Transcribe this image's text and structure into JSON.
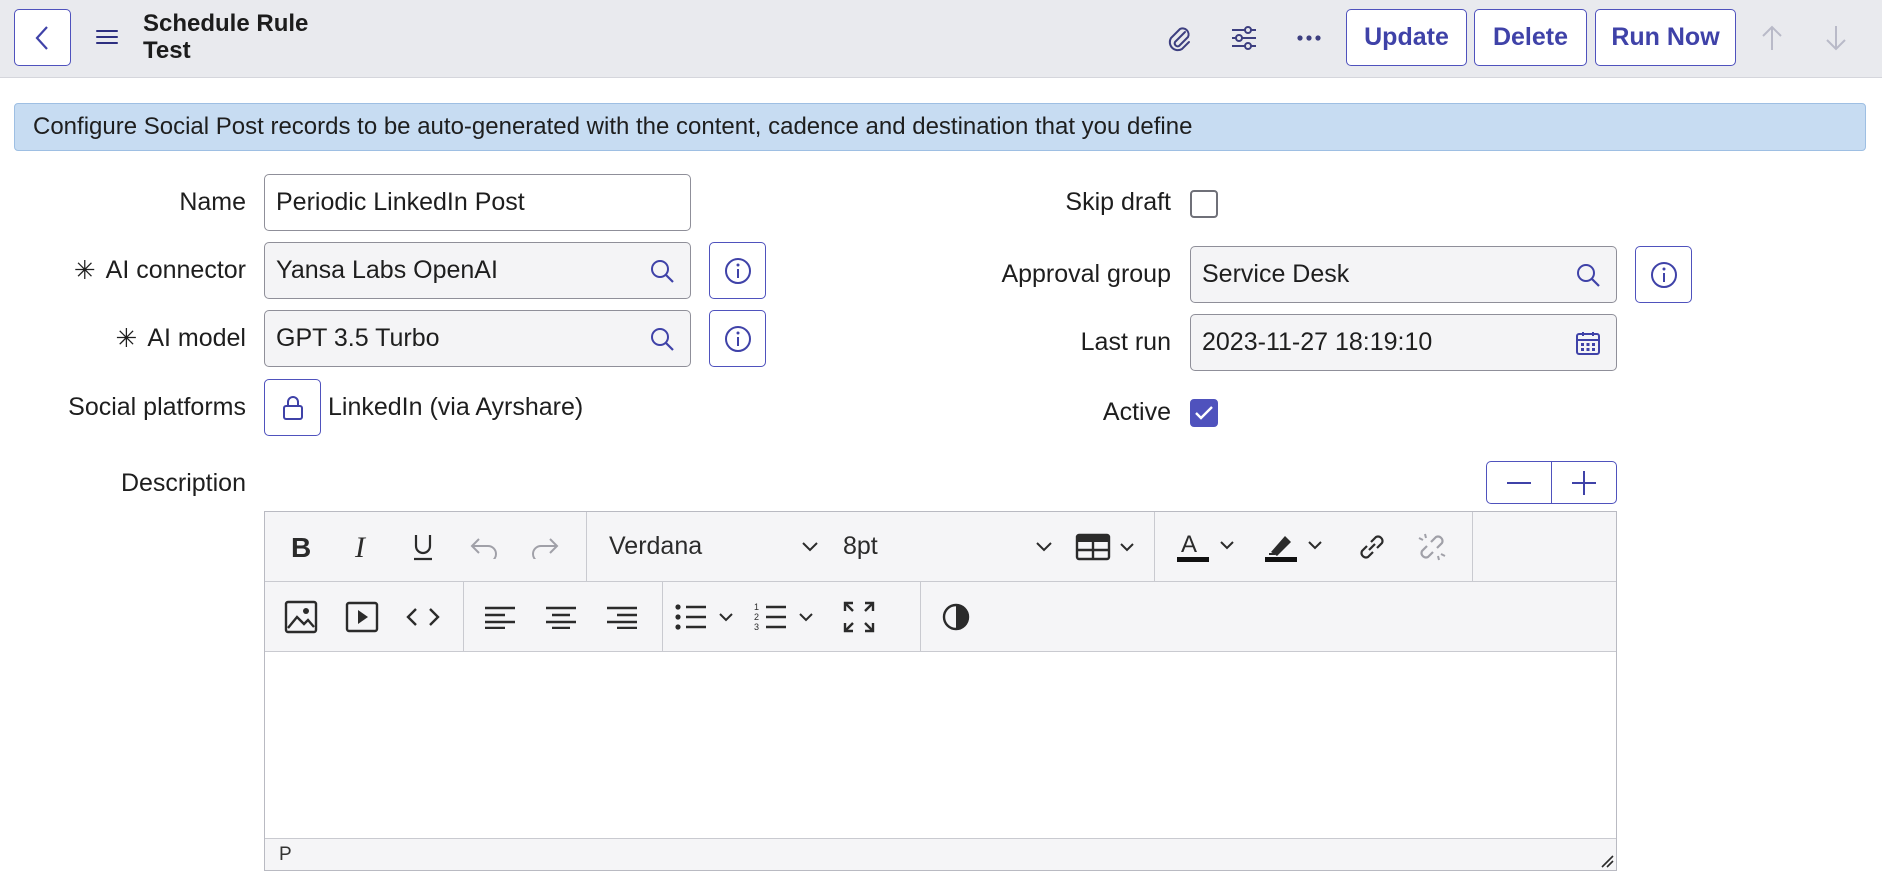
{
  "header": {
    "title": "Schedule Rule Test",
    "buttons": {
      "update": "Update",
      "delete": "Delete",
      "run_now": "Run Now"
    }
  },
  "banner": {
    "text": "Configure Social Post records to be auto-generated with the content, cadence and destination that you define"
  },
  "form": {
    "name": {
      "label": "Name",
      "value": "Periodic LinkedIn Post"
    },
    "ai_connector": {
      "label": "AI connector",
      "value": "Yansa Labs OpenAI",
      "required_mark": "✳"
    },
    "ai_model": {
      "label": "AI model",
      "value": "GPT 3.5 Turbo",
      "required_mark": "✳"
    },
    "social_platforms": {
      "label": "Social platforms",
      "value": "LinkedIn (via Ayrshare)"
    },
    "skip_draft": {
      "label": "Skip draft",
      "checked": false
    },
    "approval_group": {
      "label": "Approval group",
      "value": "Service Desk"
    },
    "last_run": {
      "label": "Last run",
      "value": "2023-11-27 18:19:10"
    },
    "active": {
      "label": "Active",
      "checked": true
    },
    "description": {
      "label": "Description"
    }
  },
  "editor": {
    "font_family": "Verdana",
    "font_size": "8pt",
    "status_path": "P"
  },
  "colors": {
    "accent": "#4f52bd",
    "banner_bg": "#c7dcf2",
    "header_bg": "#e9eaee"
  }
}
